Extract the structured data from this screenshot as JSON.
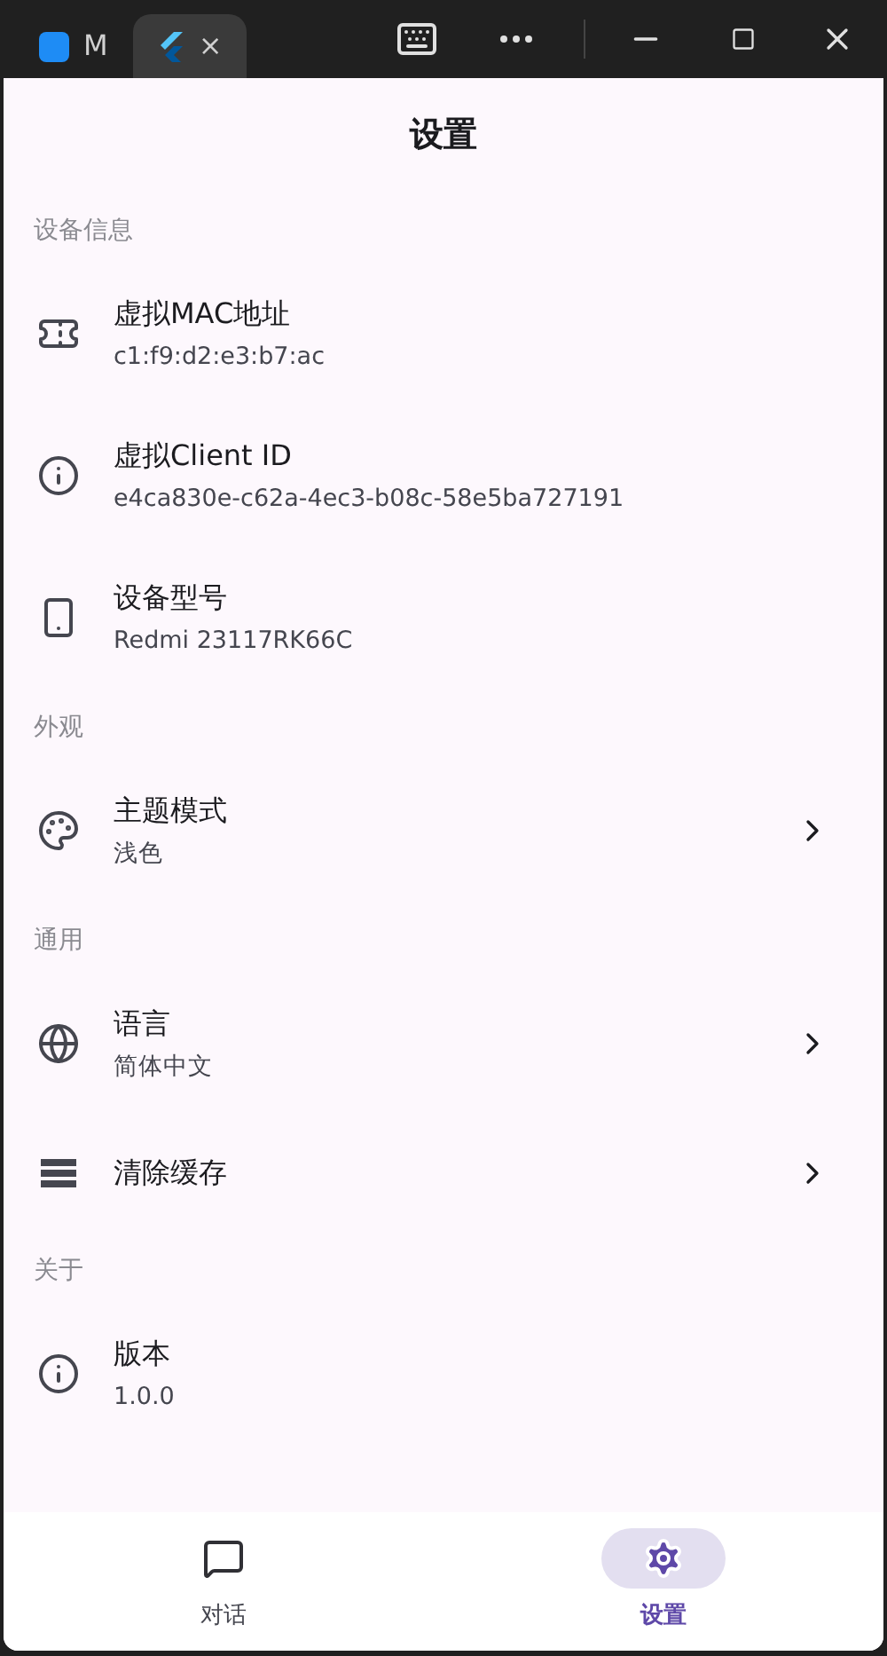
{
  "titlebar": {
    "tabs": [
      {
        "label": "M",
        "selected": false,
        "kind": "app"
      },
      {
        "label": "×",
        "selected": true,
        "kind": "flutter"
      }
    ]
  },
  "header": {
    "title": "设置"
  },
  "sections": [
    {
      "title": "设备信息",
      "items": [
        {
          "title": "虚拟MAC地址",
          "subtitle": "c1:f9:d2:e3:b7:ac",
          "chevron": false
        },
        {
          "title": "虚拟Client ID",
          "subtitle": "e4ca830e-c62a-4ec3-b08c-58e5ba727191",
          "chevron": false
        },
        {
          "title": "设备型号",
          "subtitle": "Redmi 23117RK66C",
          "chevron": false
        }
      ]
    },
    {
      "title": "外观",
      "items": [
        {
          "title": "主题模式",
          "subtitle": "浅色",
          "chevron": true
        }
      ]
    },
    {
      "title": "通用",
      "items": [
        {
          "title": "语言",
          "subtitle": "简体中文",
          "chevron": true
        },
        {
          "title": "清除缓存",
          "chevron": true
        }
      ]
    },
    {
      "title": "关于",
      "items": [
        {
          "title": "版本",
          "subtitle": "1.0.0",
          "chevron": false
        }
      ]
    }
  ],
  "nav": [
    {
      "label": "对话",
      "selected": false
    },
    {
      "label": "设置",
      "selected": true
    }
  ]
}
